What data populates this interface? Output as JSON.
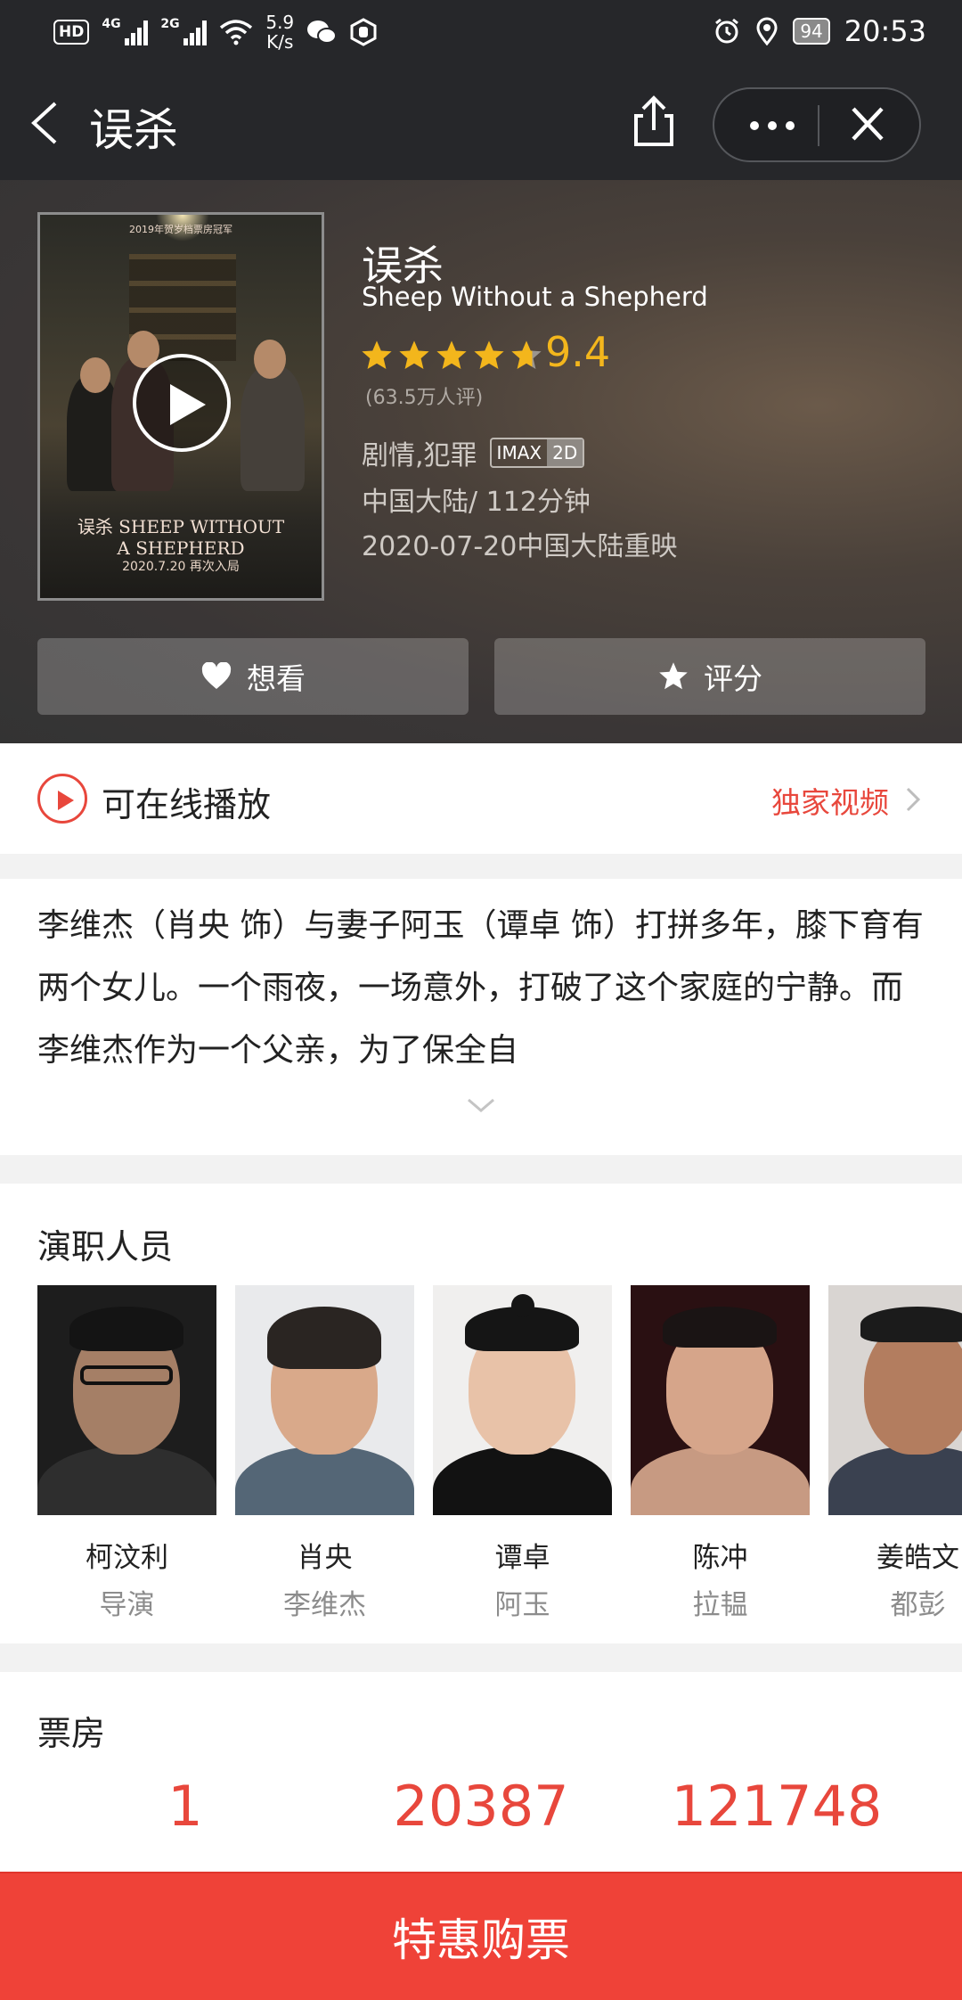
{
  "status_bar": {
    "hd": "HD",
    "net1": "4G",
    "net2": "2G",
    "speed_value": "5.9",
    "speed_unit": "K/s",
    "battery": "94",
    "time": "20:53"
  },
  "title_bar": {
    "title": "误杀"
  },
  "movie": {
    "title": "误杀",
    "english_title": "Sheep Without a Shepherd",
    "rating": "9.4",
    "rating_stars_value": 4.7,
    "votes": "(63.5万人评)",
    "genre": "剧情,犯罪",
    "tag_format": "IMAX",
    "tag_dim": "2D",
    "region_duration": "中国大陆/ 112分钟",
    "release": "2020-07-20中国大陆重映",
    "poster": {
      "top_line": "2019年贺岁档票房冠军",
      "title": "误杀 SHEEP WITHOUT A SHEPHERD",
      "date": "2020.7.20 再次入局"
    }
  },
  "actions": {
    "want": "想看",
    "rate": "评分"
  },
  "online": {
    "label": "可在线播放",
    "link": "独家视频"
  },
  "synopsis": {
    "text": "李维杰（肖央 饰）与妻子阿玉（谭卓 饰）打拼多年，膝下育有两个女儿。一个雨夜，一场意外，打破了这个家庭的宁静。而李维杰作为一个父亲，为了保全自"
  },
  "cast": {
    "title": "演职人员",
    "people": [
      {
        "name": "柯汶利",
        "role": "导演"
      },
      {
        "name": "肖央",
        "role": "李维杰"
      },
      {
        "name": "谭卓",
        "role": "阿玉"
      },
      {
        "name": "陈冲",
        "role": "拉韫"
      },
      {
        "name": "姜皓文",
        "role": "都彭"
      }
    ]
  },
  "box_office": {
    "title": "票房",
    "values": [
      "1",
      "20387",
      "121748"
    ]
  },
  "buy": {
    "label": "特惠购票"
  },
  "colors": {
    "accent_red": "#ef4238",
    "star_gold": "#f3b61c",
    "header_bg": "#26272a"
  }
}
